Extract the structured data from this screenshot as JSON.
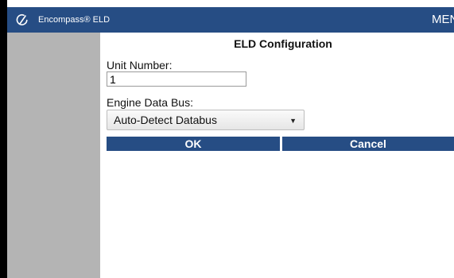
{
  "app": {
    "title": "Encompass® ELD",
    "menu_label": "MENU",
    "logo_icon": "encompass-logo-icon"
  },
  "colors": {
    "header": "#264d84",
    "sidebar": "#b4b4b4",
    "button": "#264d84"
  },
  "form": {
    "title": "ELD Configuration",
    "unit_number_label": "Unit Number:",
    "unit_number_value": "1",
    "engine_bus_label": "Engine Data Bus:",
    "engine_bus_selected": "Auto-Detect Databus",
    "engine_bus_caret_icon": "dropdown-caret-icon"
  },
  "buttons": {
    "ok_label": "OK",
    "cancel_label": "Cancel"
  }
}
